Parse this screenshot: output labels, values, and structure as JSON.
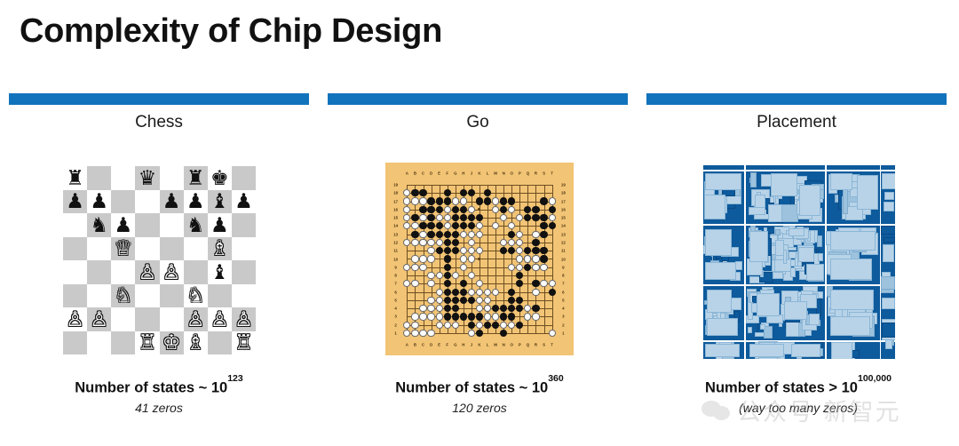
{
  "slide": {
    "title": "Complexity of Chip Design",
    "accent_color": "#1273bd",
    "background": "#ffffff"
  },
  "columns": [
    {
      "heading": "Chess",
      "figure": "chess-board",
      "caption_main_text": "Number of states ~ 10",
      "caption_main_exponent": "123",
      "caption_sub": "41 zeros"
    },
    {
      "heading": "Go",
      "figure": "go-board",
      "caption_main_text": "Number of states ~ 10",
      "caption_main_exponent": "360",
      "caption_sub": "120 zeros"
    },
    {
      "heading": "Placement",
      "figure": "chip-placement",
      "caption_main_text": "Number of states > 10",
      "caption_main_exponent": "100,000",
      "caption_sub": "(way too many zeros)"
    }
  ],
  "chess": {
    "light_square_color": "#ffffff",
    "dark_square_color": "#c9c9c9",
    "ranks": [
      [
        "r",
        "",
        "",
        "q",
        "",
        "r",
        "k",
        ""
      ],
      [
        "p",
        "p",
        "",
        "",
        "p",
        "p",
        "b",
        "p"
      ],
      [
        "",
        "n",
        "p",
        "",
        "",
        "n",
        "p",
        ""
      ],
      [
        "",
        "",
        "Q",
        "",
        "",
        "",
        "B",
        ""
      ],
      [
        "",
        "",
        "",
        "P",
        "P",
        "",
        "b",
        ""
      ],
      [
        "",
        "",
        "N",
        "",
        "",
        "N",
        "",
        ""
      ],
      [
        "P",
        "P",
        "",
        "",
        "",
        "P",
        "P",
        "P"
      ],
      [
        "",
        "",
        "",
        "R",
        "K",
        "B",
        "",
        "R"
      ]
    ],
    "glyphs": {
      "k": "♚",
      "q": "♛",
      "r": "♜",
      "b": "♝",
      "n": "♞",
      "p": "♟",
      "K": "♔",
      "Q": "♕",
      "R": "♖",
      "B": "♗",
      "N": "♘",
      "P": "♙"
    }
  },
  "go": {
    "board_color": "#f2c475",
    "size": 19,
    "column_labels": [
      "A",
      "B",
      "C",
      "D",
      "E",
      "F",
      "G",
      "H",
      "J",
      "K",
      "L",
      "M",
      "N",
      "O",
      "P",
      "Q",
      "R",
      "S",
      "T"
    ],
    "row_labels": [
      "19",
      "18",
      "17",
      "16",
      "15",
      "14",
      "13",
      "12",
      "11",
      "10",
      "9",
      "8",
      "7",
      "6",
      "5",
      "4",
      "3",
      "2",
      "1"
    ],
    "black_stones": [
      [
        1,
        1
      ],
      [
        2,
        1
      ],
      [
        5,
        1
      ],
      [
        7,
        1
      ],
      [
        8,
        1
      ],
      [
        10,
        1
      ],
      [
        3,
        2
      ],
      [
        4,
        2
      ],
      [
        5,
        2
      ],
      [
        9,
        2
      ],
      [
        10,
        2
      ],
      [
        12,
        2
      ],
      [
        13,
        2
      ],
      [
        17,
        2
      ],
      [
        2,
        3
      ],
      [
        3,
        3
      ],
      [
        4,
        3
      ],
      [
        6,
        3
      ],
      [
        7,
        3
      ],
      [
        12,
        3
      ],
      [
        15,
        3
      ],
      [
        16,
        3
      ],
      [
        18,
        3
      ],
      [
        1,
        4
      ],
      [
        3,
        4
      ],
      [
        6,
        4
      ],
      [
        7,
        4
      ],
      [
        8,
        4
      ],
      [
        9,
        4
      ],
      [
        15,
        4
      ],
      [
        16,
        4
      ],
      [
        17,
        4
      ],
      [
        2,
        5
      ],
      [
        3,
        5
      ],
      [
        4,
        5
      ],
      [
        6,
        5
      ],
      [
        7,
        5
      ],
      [
        8,
        5
      ],
      [
        17,
        5
      ],
      [
        18,
        5
      ],
      [
        1,
        6
      ],
      [
        3,
        6
      ],
      [
        4,
        6
      ],
      [
        5,
        6
      ],
      [
        6,
        6
      ],
      [
        13,
        6
      ],
      [
        17,
        6
      ],
      [
        2,
        7
      ],
      [
        5,
        7
      ],
      [
        6,
        7
      ],
      [
        16,
        7
      ],
      [
        4,
        8
      ],
      [
        5,
        8
      ],
      [
        6,
        8
      ],
      [
        12,
        8
      ],
      [
        13,
        8
      ],
      [
        15,
        8
      ],
      [
        16,
        8
      ],
      [
        17,
        8
      ],
      [
        5,
        9
      ],
      [
        15,
        9
      ],
      [
        16,
        9
      ],
      [
        17,
        9
      ],
      [
        5,
        10
      ],
      [
        15,
        10
      ],
      [
        16,
        10
      ],
      [
        5,
        11
      ],
      [
        14,
        11
      ],
      [
        5,
        12
      ],
      [
        7,
        12
      ],
      [
        14,
        12
      ],
      [
        16,
        12
      ],
      [
        5,
        13
      ],
      [
        6,
        13
      ],
      [
        7,
        13
      ],
      [
        13,
        13
      ],
      [
        18,
        13
      ],
      [
        5,
        14
      ],
      [
        6,
        14
      ],
      [
        7,
        14
      ],
      [
        8,
        14
      ],
      [
        13,
        14
      ],
      [
        14,
        14
      ],
      [
        5,
        15
      ],
      [
        6,
        15
      ],
      [
        10,
        15
      ],
      [
        11,
        15
      ],
      [
        12,
        15
      ],
      [
        13,
        15
      ],
      [
        14,
        15
      ],
      [
        16,
        15
      ],
      [
        5,
        16
      ],
      [
        6,
        16
      ],
      [
        7,
        16
      ],
      [
        8,
        16
      ],
      [
        9,
        16
      ],
      [
        12,
        16
      ],
      [
        13,
        16
      ],
      [
        8,
        17
      ],
      [
        10,
        17
      ],
      [
        11,
        17
      ],
      [
        14,
        17
      ],
      [
        9,
        18
      ],
      [
        12,
        18
      ]
    ],
    "white_stones": [
      [
        0,
        1
      ],
      [
        0,
        2
      ],
      [
        1,
        2
      ],
      [
        2,
        2
      ],
      [
        6,
        2
      ],
      [
        7,
        2
      ],
      [
        11,
        2
      ],
      [
        18,
        2
      ],
      [
        0,
        3
      ],
      [
        5,
        3
      ],
      [
        8,
        3
      ],
      [
        11,
        3
      ],
      [
        13,
        3
      ],
      [
        0,
        4
      ],
      [
        2,
        4
      ],
      [
        4,
        4
      ],
      [
        5,
        4
      ],
      [
        12,
        4
      ],
      [
        14,
        4
      ],
      [
        18,
        4
      ],
      [
        0,
        5
      ],
      [
        1,
        5
      ],
      [
        5,
        5
      ],
      [
        9,
        5
      ],
      [
        11,
        5
      ],
      [
        13,
        5
      ],
      [
        2,
        6
      ],
      [
        7,
        6
      ],
      [
        8,
        6
      ],
      [
        9,
        6
      ],
      [
        14,
        6
      ],
      [
        16,
        6
      ],
      [
        0,
        7
      ],
      [
        1,
        7
      ],
      [
        2,
        7
      ],
      [
        3,
        7
      ],
      [
        4,
        7
      ],
      [
        8,
        7
      ],
      [
        12,
        7
      ],
      [
        13,
        7
      ],
      [
        14,
        7
      ],
      [
        3,
        8
      ],
      [
        7,
        8
      ],
      [
        8,
        8
      ],
      [
        9,
        8
      ],
      [
        14,
        8
      ],
      [
        1,
        9
      ],
      [
        2,
        9
      ],
      [
        3,
        9
      ],
      [
        7,
        9
      ],
      [
        8,
        9
      ],
      [
        14,
        9
      ],
      [
        15,
        9
      ],
      [
        16,
        9
      ],
      [
        0,
        10
      ],
      [
        1,
        10
      ],
      [
        2,
        10
      ],
      [
        7,
        10
      ],
      [
        13,
        10
      ],
      [
        14,
        10
      ],
      [
        16,
        10
      ],
      [
        17,
        10
      ],
      [
        3,
        11
      ],
      [
        4,
        11
      ],
      [
        6,
        11
      ],
      [
        8,
        11
      ],
      [
        0,
        12
      ],
      [
        1,
        12
      ],
      [
        3,
        12
      ],
      [
        9,
        12
      ],
      [
        17,
        12
      ],
      [
        18,
        12
      ],
      [
        4,
        13
      ],
      [
        8,
        13
      ],
      [
        9,
        13
      ],
      [
        10,
        13
      ],
      [
        11,
        13
      ],
      [
        16,
        13
      ],
      [
        3,
        14
      ],
      [
        4,
        14
      ],
      [
        9,
        14
      ],
      [
        10,
        14
      ],
      [
        2,
        15
      ],
      [
        3,
        15
      ],
      [
        4,
        15
      ],
      [
        9,
        15
      ],
      [
        10,
        15
      ],
      [
        15,
        15
      ],
      [
        1,
        16
      ],
      [
        2,
        16
      ],
      [
        3,
        16
      ],
      [
        4,
        16
      ],
      [
        10,
        16
      ],
      [
        11,
        16
      ],
      [
        15,
        16
      ],
      [
        16,
        16
      ],
      [
        0,
        17
      ],
      [
        1,
        17
      ],
      [
        4,
        17
      ],
      [
        5,
        17
      ],
      [
        6,
        17
      ],
      [
        9,
        17
      ],
      [
        12,
        17
      ],
      [
        13,
        17
      ],
      [
        0,
        18
      ],
      [
        1,
        18
      ],
      [
        2,
        18
      ],
      [
        3,
        18
      ],
      [
        8,
        18
      ],
      [
        18,
        18
      ]
    ],
    "star_points": [
      [
        3,
        3
      ],
      [
        9,
        3
      ],
      [
        15,
        3
      ],
      [
        3,
        9
      ],
      [
        9,
        9
      ],
      [
        15,
        9
      ],
      [
        3,
        15
      ],
      [
        9,
        15
      ],
      [
        15,
        15
      ]
    ]
  },
  "placement": {
    "background_color": "#0d5a9c",
    "macro_color": "#b8d3e8",
    "channel_color": "#ffffff"
  },
  "watermark": {
    "text": "公众号 新智元",
    "icon": "wechat-icon"
  }
}
